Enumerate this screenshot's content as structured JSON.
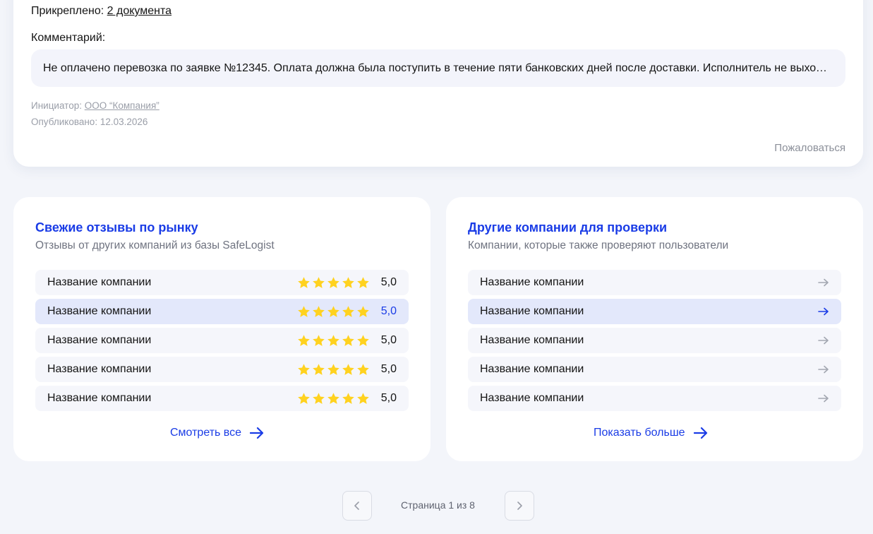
{
  "comment_card": {
    "attached_label": "Прикреплено:",
    "attached_link": "2 документа",
    "comment_label": "Комментарий:",
    "comment_text": "Не оплачено перевозка по заявке №12345. Оплата должна была поступить в течение пяти банковских дней после доставки. Исполнитель не выходит на связь.",
    "initiator_label": "Инициатор:",
    "initiator_link": "ООО “Компания”",
    "published": "Опубликовано: 12.03.2026",
    "complain_label": "Пожаловаться"
  },
  "reviews_panel": {
    "title": "Свежие отзывы по рынку",
    "subtitle": "Отзывы от других компаний из базы SafeLogist",
    "items": [
      {
        "name": "Название компании",
        "rating": 5,
        "score": "5,0"
      },
      {
        "name": "Название компании",
        "rating": 5,
        "score": "5,0"
      },
      {
        "name": "Название компании",
        "rating": 5,
        "score": "5,0"
      },
      {
        "name": "Название компании",
        "rating": 5,
        "score": "5,0"
      },
      {
        "name": "Название компании",
        "rating": 5,
        "score": "5,0"
      }
    ],
    "more_label": "Смотреть все"
  },
  "companies_panel": {
    "title": "Другие компании для проверки",
    "subtitle": "Компании, которые также проверяют пользователи",
    "items": [
      {
        "name": "Название компании"
      },
      {
        "name": "Название компании"
      },
      {
        "name": "Название компании"
      },
      {
        "name": "Название компании"
      },
      {
        "name": "Название компании"
      }
    ],
    "more_label": "Показать больше"
  },
  "pagination": {
    "label": "Страница 1 из 8"
  },
  "colors": {
    "accent": "#1a3ce6",
    "star": "#ffd21f",
    "row_bg": "#f5f6fb",
    "row_active_bg": "#e3e8fb"
  },
  "icons": {
    "star": "star-icon",
    "arrow": "arrow-right-icon",
    "prev": "chevron-left-icon",
    "next": "chevron-right-icon"
  }
}
